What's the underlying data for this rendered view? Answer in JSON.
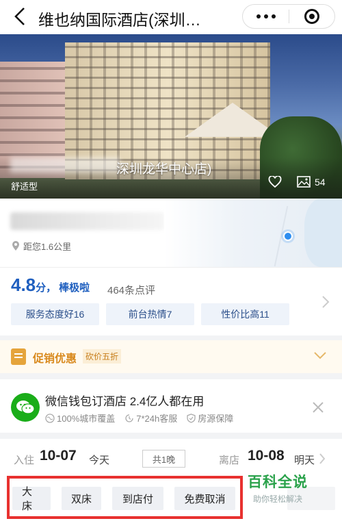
{
  "header": {
    "title": "维也纳国际酒店(深圳…"
  },
  "hero": {
    "subname": "深圳龙华中心店)",
    "tag": "舒适型",
    "photo_count": "54"
  },
  "location": {
    "distance": "距您1.6公里"
  },
  "rating": {
    "score": "4.8",
    "unit": "分，",
    "word": "棒极啦",
    "reviews": "464条点评",
    "chips": [
      "服务态度好16",
      "前台热情7",
      "性价比高11"
    ]
  },
  "promo": {
    "label": "促销优惠",
    "badge": "砍价五折"
  },
  "wechat": {
    "title": "微信钱包订酒店 2.4亿人都在用",
    "features": [
      "100%城市覆盖",
      "7*24h客服",
      "房源保障"
    ]
  },
  "dates": {
    "checkin_label": "入住",
    "checkin_date": "10-07",
    "checkin_day": "今天",
    "nights": "共1晚",
    "checkout_label": "离店",
    "checkout_date": "10-08",
    "checkout_day": "明天"
  },
  "filters": {
    "items": [
      "大床",
      "双床",
      "到店付",
      "免费取消"
    ]
  },
  "watermark": {
    "title": "百科全说",
    "subtitle": "助你轻松解决"
  },
  "colors": {
    "rating_blue": "#1f5fbf",
    "promo_orange": "#d98a1e",
    "wechat_green": "#1aad19",
    "highlight_red": "#e8312f",
    "watermark_green": "#2aa24b"
  }
}
